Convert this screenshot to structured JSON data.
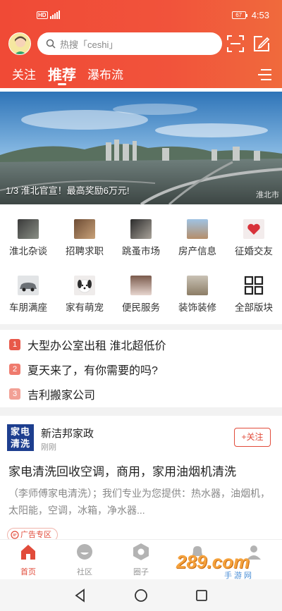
{
  "status_bar": {
    "network": "HD",
    "battery": "67",
    "time": "4:53"
  },
  "search": {
    "placeholder": "热搜「ceshi」"
  },
  "tabs": [
    {
      "label": "关注",
      "active": false
    },
    {
      "label": "推荐",
      "active": true
    },
    {
      "label": "瀑布流",
      "active": false
    }
  ],
  "banner": {
    "caption": "1/3 淮北官宣！最高奖励6万元!",
    "corner_text": "淮北市"
  },
  "categories": [
    {
      "label": "淮北杂谈",
      "icon": "photo-thumb"
    },
    {
      "label": "招聘求职",
      "icon": "photo-thumb"
    },
    {
      "label": "跳蚤市场",
      "icon": "photo-thumb"
    },
    {
      "label": "房产信息",
      "icon": "photo-thumb"
    },
    {
      "label": "征婚交友",
      "icon": "heart-thumb"
    },
    {
      "label": "车朋满座",
      "icon": "car-thumb"
    },
    {
      "label": "家有萌宠",
      "icon": "dog-thumb"
    },
    {
      "label": "便民服务",
      "icon": "photo-thumb"
    },
    {
      "label": "装饰装修",
      "icon": "photo-thumb"
    },
    {
      "label": "全部版块",
      "icon": "grid-icon"
    }
  ],
  "hot_list": [
    {
      "rank": "1",
      "text": "大型办公室出租 淮北超低价",
      "color": "#e8594a"
    },
    {
      "rank": "2",
      "text": "夏天来了，有你需要的吗?",
      "color": "#ef7b6e"
    },
    {
      "rank": "3",
      "text": "吉利搬家公司",
      "color": "#f2a095"
    }
  ],
  "post": {
    "avatar_text": "家电清洗",
    "author": "新洁邦家政",
    "time": "刚刚",
    "follow_label": "+关注",
    "title": "家电清洗回收空调，商用，家用油烟机清洗",
    "body": "（李师傅家电清洗）；我们专业为您提供：热水器，油烟机，太阳能，空调，冰箱，净水器...",
    "ad_tag": "广告专区"
  },
  "bottom_nav": [
    {
      "label": "首页",
      "active": true
    },
    {
      "label": "社区",
      "active": false
    },
    {
      "label": "圈子",
      "active": false
    },
    {
      "label": "",
      "active": false
    },
    {
      "label": "",
      "active": false
    }
  ],
  "watermark": {
    "brand": "289.com",
    "sub": "手游网"
  },
  "colors": {
    "accent": "#e14b3a",
    "header": "#f04a36"
  }
}
